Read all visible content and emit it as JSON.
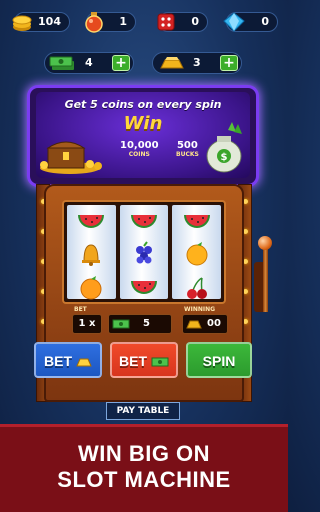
{
  "topbar": {
    "coins": "104",
    "potions": "1",
    "dice": "0",
    "gems": "0"
  },
  "resources": {
    "cash": "4",
    "gold": "3",
    "plus_label": "+"
  },
  "banner": {
    "headline": "Get 5 coins on every spin",
    "win_label": "Win",
    "coins_value": "10,000",
    "coins_label": "COINS",
    "bucks_value": "500",
    "bucks_label": "BUCKS"
  },
  "reels": [
    [
      "watermelon",
      "bell",
      "orange"
    ],
    [
      "watermelon",
      "grapes",
      "watermelon"
    ],
    [
      "watermelon",
      "orange",
      "cherries"
    ]
  ],
  "info": {
    "bet_label": "BET",
    "bet_multiplier": "1 x",
    "bet_value": "5",
    "winning_label": "WINNING",
    "winning_value": "00"
  },
  "buttons": {
    "bet_max": "BET",
    "bet_cash": "BET",
    "spin": "SPIN",
    "pay_table": "PAY TABLE"
  },
  "tagline": {
    "line1": "WIN BIG ON",
    "line2": "SLOT MACHINE"
  },
  "colors": {
    "bet_blue": "#1c57c2",
    "bet_red": "#d8351e",
    "spin_green": "#2c9b2e",
    "footer_red": "#7a0f17",
    "banner_purple": "#3a1488"
  }
}
